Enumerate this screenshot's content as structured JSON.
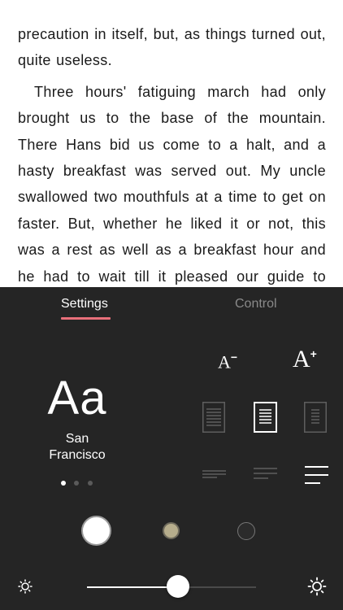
{
  "reader": {
    "paragraphs": [
      "precaution in itself, but, as things turned out, quite useless.",
      "Three hours' fatiguing march had only brought us to the base of the mountain. There Hans bid us come to a halt, and a hasty breakfast was served out. My uncle swallowed two mouthfuls at a time to get on faster. But, whether he liked it or not, this was a rest as well as a breakfast hour and he had to wait till it pleased our guide to move on, which he did in an hour."
    ]
  },
  "settings_panel": {
    "tabs": [
      {
        "label": "Settings",
        "active": true
      },
      {
        "label": "Control",
        "active": false
      }
    ],
    "font": {
      "preview": "Aa",
      "name": "San Francisco",
      "page_indicator": {
        "count": 3,
        "active_index": 0
      }
    },
    "font_size": {
      "decrease_label": "A",
      "decrease_mark": "−",
      "increase_label": "A",
      "increase_mark": "+"
    },
    "margins": {
      "options": [
        "narrow",
        "medium",
        "wide"
      ],
      "selected": "medium"
    },
    "line_spacing": {
      "options": [
        "compact",
        "normal",
        "relaxed"
      ],
      "selected": "relaxed"
    },
    "themes": {
      "options": [
        {
          "name": "white",
          "color": "#ffffff"
        },
        {
          "name": "sepia",
          "color": "#b6ad8c"
        },
        {
          "name": "dark",
          "color": "#2b2b2b"
        }
      ],
      "selected": "white"
    },
    "brightness": {
      "value": 0.54,
      "low_icon": "sun-small-icon",
      "high_icon": "sun-large-icon"
    }
  },
  "colors": {
    "panel_bg": "#252525",
    "accent": "#e8707a",
    "text": "#1a1a1a"
  }
}
